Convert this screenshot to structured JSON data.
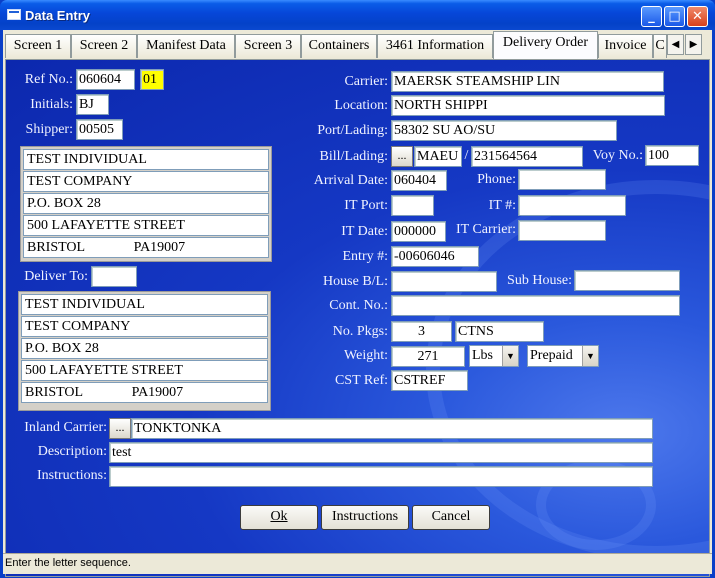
{
  "window": {
    "title": "Data Entry",
    "min_glyph": "_",
    "max_glyph": "□",
    "close_glyph": "✕"
  },
  "tabs": [
    {
      "label": "Screen 1"
    },
    {
      "label": "Screen 2"
    },
    {
      "label": "Manifest Data"
    },
    {
      "label": "Screen 3"
    },
    {
      "label": "Containers"
    },
    {
      "label": "3461 Information"
    },
    {
      "label": "Delivery Order"
    },
    {
      "label": "Invoice"
    },
    {
      "label": "C"
    }
  ],
  "tab_scroll": {
    "left": "◀",
    "right": "▶"
  },
  "form": {
    "ref_no": {
      "label": "Ref No.:",
      "value": "060604",
      "suffix": "01"
    },
    "initials": {
      "label": "Initials:",
      "value": "BJ"
    },
    "shipper": {
      "label": "Shipper:",
      "value": "00505"
    },
    "shipper_address": [
      "TEST INDIVIDUAL",
      "TEST COMPANY",
      "P.O. BOX 28",
      "500 LAFAYETTE STREET",
      "BRISTOL              PA19007"
    ],
    "deliver_to": {
      "label": "Deliver To:",
      "value": ""
    },
    "deliver_address": [
      "TEST INDIVIDUAL",
      "TEST COMPANY",
      "P.O. BOX 28",
      "500 LAFAYETTE STREET",
      "BRISTOL              PA19007"
    ],
    "carrier": {
      "label": "Carrier:",
      "value": "MAERSK STEAMSHIP LIN"
    },
    "location": {
      "label": "Location:",
      "value": "NORTH SHIPPI"
    },
    "port_lading": {
      "label": "Port/Lading:",
      "value": "58302 SU AO/SU"
    },
    "bill_lading": {
      "label": "Bill/Lading:",
      "prefix": "MAEU",
      "slash": "/",
      "value": "231564564",
      "button": "..."
    },
    "voy_no": {
      "label": "Voy No.:",
      "value": "100"
    },
    "arrival_date": {
      "label": "Arrival Date:",
      "value": "060404"
    },
    "phone": {
      "label": "Phone:",
      "value": ""
    },
    "it_port": {
      "label": "IT Port:",
      "value": ""
    },
    "it_no": {
      "label": "IT #:",
      "value": ""
    },
    "it_date": {
      "label": "IT Date:",
      "value": "000000"
    },
    "it_carrier": {
      "label": "IT Carrier:",
      "value": ""
    },
    "entry_no": {
      "label": "Entry #:",
      "value": "-00606046"
    },
    "house_bl": {
      "label": "House B/L:",
      "value": ""
    },
    "sub_house": {
      "label": "Sub House:",
      "value": ""
    },
    "cont_no": {
      "label": "Cont. No.:",
      "value": ""
    },
    "no_pkgs": {
      "label": "No. Pkgs:",
      "value": "3",
      "unit": "CTNS"
    },
    "weight": {
      "label": "Weight:",
      "value": "271",
      "unit": "Lbs",
      "payment": "Prepaid"
    },
    "cst_ref": {
      "label": "CST Ref:",
      "value": "CSTREF"
    },
    "inland_carrier": {
      "label": "Inland Carrier:",
      "value": "TONKTONKA",
      "button": "..."
    },
    "description": {
      "label": "Description:",
      "value": "test"
    },
    "instructions": {
      "label": "Instructions:",
      "value": ""
    }
  },
  "buttons": {
    "ok": "Ok",
    "instructions": "Instructions",
    "cancel": "Cancel"
  },
  "status": {
    "text": "Enter the letter sequence."
  }
}
